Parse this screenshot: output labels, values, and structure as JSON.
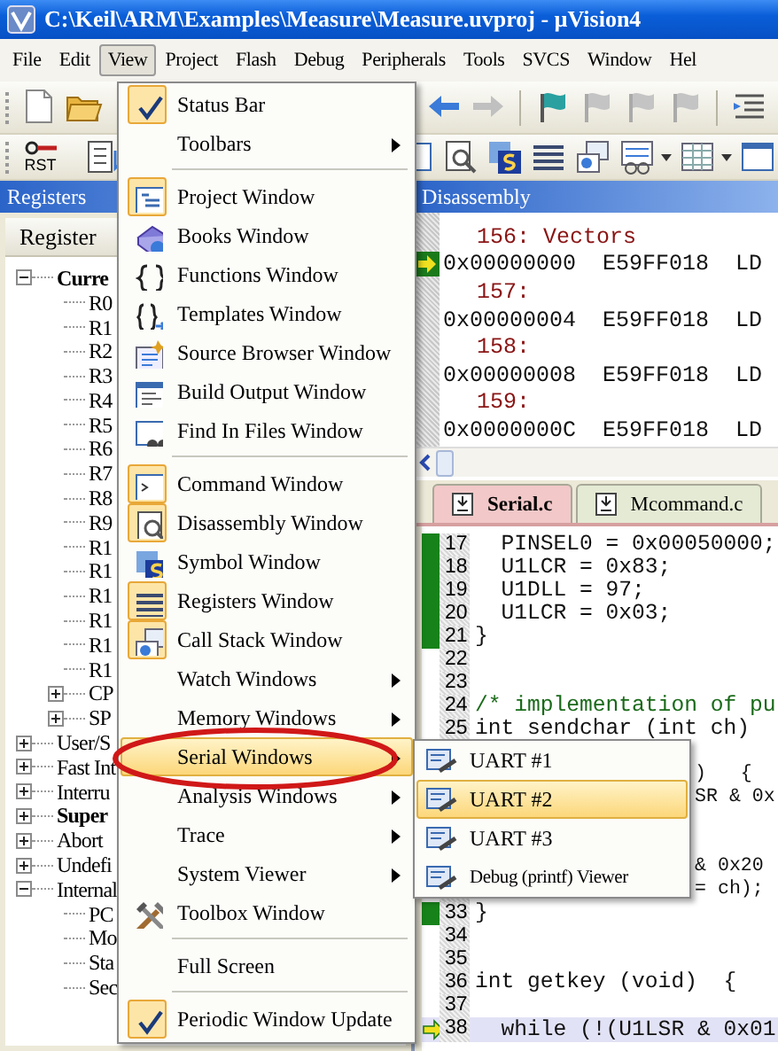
{
  "window": {
    "title": "C:\\Keil\\ARM\\Examples\\Measure\\Measure.uvproj - µVision4"
  },
  "menu_bar": [
    {
      "label": "File",
      "selected": false
    },
    {
      "label": "Edit",
      "selected": false
    },
    {
      "label": "View",
      "selected": true
    },
    {
      "label": "Project",
      "selected": false
    },
    {
      "label": "Flash",
      "selected": false
    },
    {
      "label": "Debug",
      "selected": false
    },
    {
      "label": "Peripherals",
      "selected": false
    },
    {
      "label": "Tools",
      "selected": false
    },
    {
      "label": "SVCS",
      "selected": false
    },
    {
      "label": "Window",
      "selected": false
    },
    {
      "label": "Hel",
      "selected": false
    }
  ],
  "toolbars": [
    {
      "left": [
        {
          "kind": "new"
        },
        {
          "kind": "open"
        }
      ],
      "right": [
        {
          "kind": "back"
        },
        {
          "kind": "forward"
        },
        {
          "kind": "separator"
        },
        {
          "kind": "flag"
        },
        {
          "kind": "bookmark"
        },
        {
          "kind": "bookmark"
        },
        {
          "kind": "bookmark"
        },
        {
          "kind": "separator"
        },
        {
          "kind": "indent"
        }
      ]
    },
    {
      "left": [
        {
          "kind": "reset",
          "label": "RST"
        },
        {
          "kind": "list"
        }
      ],
      "right": [
        {
          "kind": "command"
        },
        {
          "kind": "disassembly"
        },
        {
          "kind": "symbol"
        },
        {
          "kind": "registers"
        },
        {
          "kind": "callstack"
        },
        {
          "kind": "watch"
        },
        {
          "kind": "dropdown"
        },
        {
          "kind": "memory"
        },
        {
          "kind": "dropdown"
        },
        {
          "kind": "window"
        }
      ]
    }
  ],
  "registers_panel": {
    "title": "Registers",
    "column": "Register",
    "tree": [
      {
        "label": "Curre",
        "bold": true,
        "expanded": true,
        "children": [
          {
            "label": "R0",
            "bold": false
          },
          {
            "label": "R1",
            "bold": false
          },
          {
            "label": "R2",
            "bold": false
          },
          {
            "label": "R3",
            "bold": false
          },
          {
            "label": "R4",
            "bold": false
          },
          {
            "label": "R5",
            "bold": false
          },
          {
            "label": "R6",
            "bold": false
          },
          {
            "label": "R7",
            "bold": false
          },
          {
            "label": "R8",
            "bold": false
          },
          {
            "label": "R9",
            "bold": false
          },
          {
            "label": "R1",
            "bold": false
          },
          {
            "label": "R1",
            "bold": false
          },
          {
            "label": "R1",
            "bold": false
          },
          {
            "label": "R1",
            "bold": false
          },
          {
            "label": "R1",
            "bold": false
          },
          {
            "label": "R1",
            "bold": false
          },
          {
            "label": "CP",
            "bold": false,
            "expanded": false
          },
          {
            "label": "SP",
            "bold": false,
            "expanded": false
          }
        ]
      },
      {
        "label": "User/S",
        "bold": false,
        "expanded": false
      },
      {
        "label": "Fast Int",
        "bold": false,
        "expanded": false
      },
      {
        "label": "Interru",
        "bold": false,
        "expanded": false
      },
      {
        "label": "Super",
        "bold": true,
        "expanded": false
      },
      {
        "label": "Abort",
        "bold": false,
        "expanded": false
      },
      {
        "label": "Undefi",
        "bold": false,
        "expanded": false
      },
      {
        "label": "Internal",
        "bold": false,
        "expanded": true,
        "children": [
          {
            "label": "PC",
            "bold": false
          },
          {
            "label": "Mo",
            "bold": false
          },
          {
            "label": "Sta",
            "bold": false
          },
          {
            "label": "Sec",
            "bold": false
          }
        ]
      }
    ]
  },
  "disassembly": {
    "title": "Disassembly",
    "lines": [
      {
        "kind": "source",
        "text": "156: Vectors"
      },
      {
        "kind": "code",
        "text": "0x00000000  E59FF018  LD",
        "current": true
      },
      {
        "kind": "source",
        "text": "157:"
      },
      {
        "kind": "code",
        "text": "0x00000004  E59FF018  LD",
        "current": false
      },
      {
        "kind": "source",
        "text": "158:"
      },
      {
        "kind": "code",
        "text": "0x00000008  E59FF018  LD",
        "current": false
      },
      {
        "kind": "source",
        "text": "159:"
      },
      {
        "kind": "code",
        "text": "0x0000000C  E59FF018  LD",
        "current": false
      }
    ]
  },
  "editor": {
    "tabs": [
      {
        "label": "Serial.c",
        "selected": true
      },
      {
        "label": "Mcommand.c",
        "selected": false
      }
    ],
    "lines": [
      {
        "kind": "code",
        "number": "17",
        "code": "  PINSEL0 = 0x00050000;",
        "executed": true,
        "current": false
      },
      {
        "kind": "code",
        "number": "18",
        "code": "  U1LCR = 0x83;",
        "executed": true,
        "current": false
      },
      {
        "kind": "code",
        "number": "19",
        "code": "  U1DLL = 97;",
        "executed": true,
        "current": false
      },
      {
        "kind": "code",
        "number": "20",
        "code": "  U1LCR = 0x03;",
        "executed": true,
        "current": false
      },
      {
        "kind": "code",
        "number": "21",
        "code": "}",
        "executed": true,
        "current": false
      },
      {
        "kind": "code",
        "number": "22",
        "executed": false,
        "current": false
      },
      {
        "kind": "code",
        "number": "23",
        "executed": false,
        "current": false
      },
      {
        "kind": "comment",
        "number": "24",
        "code": "/* implementation of pu",
        "executed": false,
        "current": false
      },
      {
        "kind": "code",
        "number": "25",
        "code": "int sendchar (int ch)",
        "executed": false,
        "current": false
      },
      {
        "kind": "covered"
      },
      {
        "kind": "covered",
        "tail": ")   {"
      },
      {
        "kind": "covered",
        "tail": "SR & 0x"
      },
      {
        "kind": "covered"
      },
      {
        "kind": "covered"
      },
      {
        "kind": "covered",
        "tail": "& 0x20"
      },
      {
        "kind": "covered",
        "tail": "= ch);"
      },
      {
        "kind": "code",
        "number": "33",
        "code": "}",
        "executed": true,
        "current": false
      },
      {
        "kind": "code",
        "number": "34",
        "executed": false,
        "current": false
      },
      {
        "kind": "code",
        "number": "35",
        "executed": false,
        "current": false
      },
      {
        "kind": "code",
        "number": "36",
        "code": "int getkey (void)  {",
        "executed": false,
        "current": false
      },
      {
        "kind": "code",
        "number": "37",
        "executed": false,
        "current": false
      },
      {
        "kind": "code",
        "number": "38",
        "code": "  while (!(U1LSR & 0x01",
        "executed": false,
        "current": true
      }
    ]
  },
  "view_menu": {
    "items": [
      {
        "kind": "command",
        "label": "Status Bar",
        "checked": true,
        "selected": false
      },
      {
        "kind": "submenu",
        "label": "Toolbars",
        "selected": false
      },
      {
        "kind": "separator"
      },
      {
        "kind": "command",
        "label": "Project Window",
        "checked": true,
        "selected": false
      },
      {
        "kind": "command",
        "label": "Books Window",
        "checked": false,
        "selected": false
      },
      {
        "kind": "command",
        "label": "Functions Window",
        "checked": false,
        "selected": false
      },
      {
        "kind": "command",
        "label": "Templates Window",
        "checked": false,
        "selected": false
      },
      {
        "kind": "command",
        "label": "Source Browser Window",
        "checked": false,
        "selected": false
      },
      {
        "kind": "command",
        "label": "Build Output Window",
        "checked": false,
        "selected": false
      },
      {
        "kind": "command",
        "label": "Find In Files Window",
        "checked": false,
        "selected": false
      },
      {
        "kind": "separator"
      },
      {
        "kind": "command",
        "label": "Command Window",
        "checked": true,
        "selected": false
      },
      {
        "kind": "command",
        "label": "Disassembly Window",
        "checked": true,
        "selected": false
      },
      {
        "kind": "command",
        "label": "Symbol Window",
        "checked": false,
        "selected": false
      },
      {
        "kind": "command",
        "label": "Registers Window",
        "checked": true,
        "selected": false
      },
      {
        "kind": "command",
        "label": "Call Stack Window",
        "checked": true,
        "selected": false
      },
      {
        "kind": "submenu",
        "label": "Watch Windows",
        "selected": false
      },
      {
        "kind": "submenu",
        "label": "Memory Windows",
        "selected": false
      },
      {
        "kind": "submenu",
        "label": "Serial Windows",
        "selected": true
      },
      {
        "kind": "submenu",
        "label": "Analysis Windows",
        "selected": false
      },
      {
        "kind": "submenu",
        "label": "Trace",
        "selected": false
      },
      {
        "kind": "submenu",
        "label": "System Viewer",
        "selected": false
      },
      {
        "kind": "command",
        "label": "Toolbox Window",
        "checked": false,
        "selected": false
      },
      {
        "kind": "separator"
      },
      {
        "kind": "command",
        "label": "Full Screen",
        "checked": false,
        "selected": false
      },
      {
        "kind": "separator"
      },
      {
        "kind": "command",
        "label": "Periodic Window Update",
        "checked": true,
        "selected": false
      }
    ]
  },
  "serial_submenu": {
    "items": [
      {
        "label": "UART #1",
        "selected": false
      },
      {
        "label": "UART #2",
        "selected": true
      },
      {
        "label": "UART #3",
        "selected": false
      },
      {
        "label": "Debug (printf) Viewer",
        "selected": false
      }
    ]
  }
}
